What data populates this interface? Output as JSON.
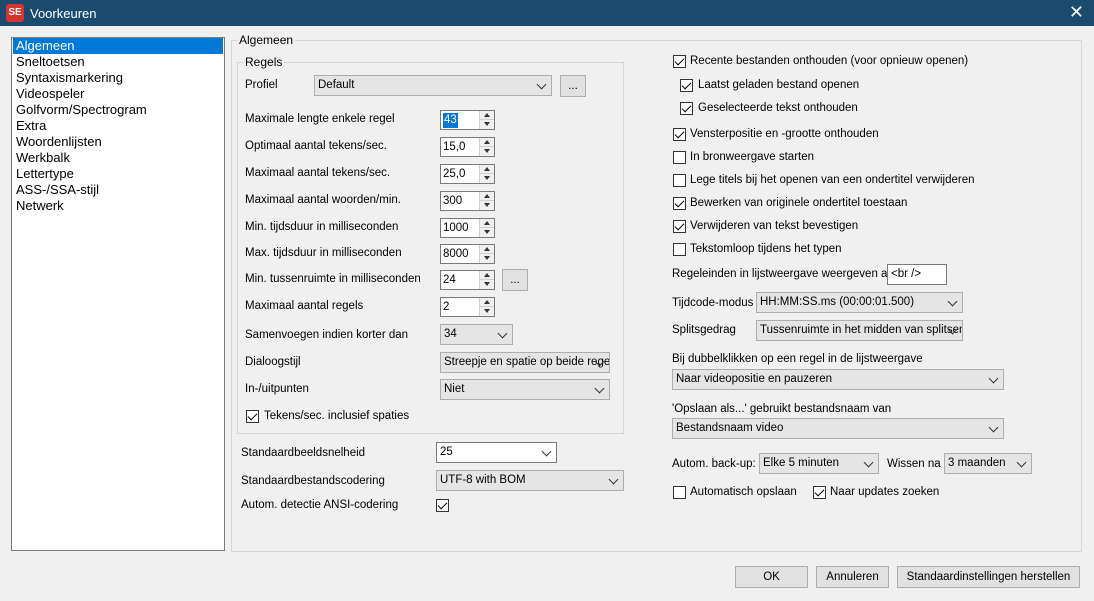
{
  "window": {
    "title": "Voorkeuren",
    "icon_text": "SE",
    "close_glyph": "✕"
  },
  "sidebar": {
    "items": [
      "Algemeen",
      "Sneltoetsen",
      "Syntaxismarkering",
      "Videospeler",
      "Golfvorm/Spectrogram",
      "Extra",
      "Woordenlijsten",
      "Werkbalk",
      "Lettertype",
      "ASS-/SSA-stijl",
      "Netwerk"
    ],
    "selected": "Algemeen"
  },
  "general": {
    "caption": "Algemeen",
    "rules": {
      "caption": "Regels",
      "profile_label": "Profiel",
      "profile_value": "Default",
      "profile_button": "...",
      "max_single_line_label": "Maximale lengte enkele regel",
      "max_single_line_value": "43",
      "optimal_cps_label": "Optimaal aantal tekens/sec.",
      "optimal_cps_value": "15,0",
      "max_cps_label": "Maximaal aantal tekens/sec.",
      "max_cps_value": "25,0",
      "max_wpm_label": "Maximaal aantal woorden/min.",
      "max_wpm_value": "300",
      "min_duration_label": "Min. tijdsduur in milliseconden",
      "min_duration_value": "1000",
      "max_duration_label": "Max. tijdsduur in milliseconden",
      "max_duration_value": "8000",
      "min_gap_label": "Min. tussenruimte in milliseconden",
      "min_gap_value": "24",
      "min_gap_button": "...",
      "max_lines_label": "Maximaal aantal regels",
      "max_lines_value": "2",
      "merge_label": "Samenvoegen indien korter dan",
      "merge_value": "34",
      "dialog_style_label": "Dialoogstijl",
      "dialog_style_value": "Streepje en spatie op beide regels",
      "inout_label": "In-/uitpunten",
      "inout_value": "Niet",
      "cps_spaces_label": "Tekens/sec. inclusief spaties",
      "cps_spaces_checked": true
    },
    "frame_rate_label": "Standaardbeeldsnelheid",
    "frame_rate_value": "25",
    "encoding_label": "Standaardbestandscodering",
    "encoding_value": "UTF-8 with BOM",
    "ansi_detect_label": "Autom. detectie ANSI-codering",
    "ansi_detect_checked": true
  },
  "right": {
    "remember_recent_label": "Recente bestanden onthouden (voor opnieuw openen)",
    "remember_recent_checked": true,
    "open_last_label": "Laatst geladen bestand openen",
    "open_last_checked": true,
    "remember_selection_label": "Geselecteerde tekst onthouden",
    "remember_selection_checked": true,
    "window_pos_label": "Vensterpositie en -grootte onthouden",
    "window_pos_checked": true,
    "source_view_label": "In bronweergave starten",
    "source_view_checked": false,
    "remove_empty_label": "Lege titels bij het openen van een ondertitel verwijderen",
    "remove_empty_checked": false,
    "edit_original_label": "Bewerken van originele ondertitel toestaan",
    "edit_original_checked": true,
    "confirm_delete_label": "Verwijderen van tekst bevestigen",
    "confirm_delete_checked": true,
    "text_flow_label": "Tekstomloop tijdens het typen",
    "text_flow_checked": false,
    "line_breaks_label": "Regeleinden in lijstweergave weergeven als",
    "line_breaks_value": "<br />",
    "timecode_label": "Tijdcode-modus",
    "timecode_value": "HH:MM:SS.ms (00:00:01.500)",
    "split_label": "Splitsgedrag",
    "split_value": "Tussenruimte in het midden van splitsen",
    "dblclick_label": "Bij dubbelklikken op een regel in de lijstweergave",
    "dblclick_value": "Naar videopositie en pauzeren",
    "saveas_label": "'Opslaan als...' gebruikt bestandsnaam van",
    "saveas_value": "Bestandsnaam video",
    "backup_label": "Autom. back-up:",
    "backup_value": "Elke 5 minuten",
    "delete_after_label": "Wissen na",
    "delete_after_value": "3 maanden",
    "autosave_label": "Automatisch opslaan",
    "autosave_checked": false,
    "check_updates_label": "Naar updates zoeken",
    "check_updates_checked": true
  },
  "footer": {
    "ok_label": "OK",
    "cancel_label": "Annuleren",
    "restore_label": "Standaardinstellingen herstellen"
  },
  "colors": {
    "titlebar": "#1a4a6e",
    "selection": "#0078d7",
    "background": "#f0f0f0"
  }
}
